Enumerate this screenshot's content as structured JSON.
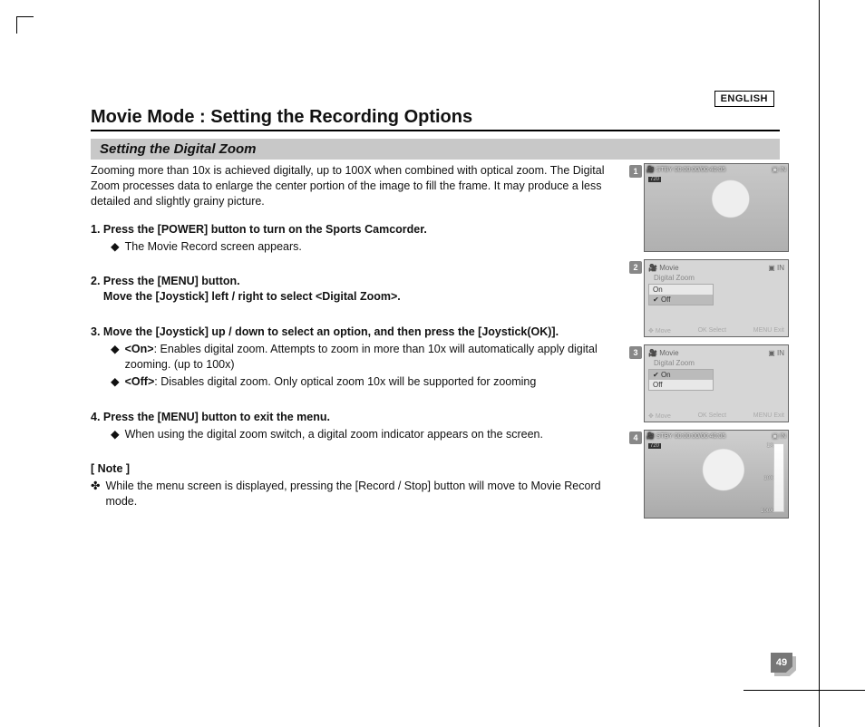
{
  "language_tag": "ENGLISH",
  "page_number": "49",
  "title": "Movie Mode : Setting the Recording Options",
  "subtitle": "Setting the Digital Zoom",
  "intro": "Zooming more than 10x is achieved digitally, up to 100X when combined with optical zoom. The Digital Zoom processes data to enlarge the center portion of the image to fill the frame. It may produce a less detailed and slightly grainy picture.",
  "steps": [
    {
      "num": "1.",
      "head": "Press the [POWER] button to turn on the Sports Camcorder.",
      "subs": [
        {
          "bullet": "◆",
          "text": "The Movie Record screen appears."
        }
      ]
    },
    {
      "num": "2.",
      "head_a": "Press the [MENU] button.",
      "head_b": "Move the [Joystick] left / right to select <Digital Zoom>.",
      "subs": []
    },
    {
      "num": "3.",
      "head": "Move the [Joystick] up / down to select an option, and then press the [Joystick(OK)].",
      "subs": [
        {
          "bullet": "◆",
          "label": "<On>",
          "text": ": Enables digital zoom. Attempts to zoom in more than 10x will automatically apply digital zooming. (up to 100x)"
        },
        {
          "bullet": "◆",
          "label": "<Off>",
          "text": ": Disables digital zoom. Only optical zoom 10x will be supported for zooming"
        }
      ]
    },
    {
      "num": "4.",
      "head": "Press the [MENU] button to exit the menu.",
      "subs": [
        {
          "bullet": "◆",
          "text": "When using the digital zoom switch, a digital zoom indicator appears on the screen."
        }
      ]
    }
  ],
  "note_head": "[ Note ]",
  "note_bullet": "✤",
  "note_text": "While the menu screen is displayed, pressing the [Record / Stop] button will move to Movie Record mode.",
  "figs": {
    "f1": {
      "stby": "STBY",
      "time": "00:00:00/00:40:05",
      "mem": "IN",
      "res": "720"
    },
    "f2": {
      "mode": "Movie",
      "setting": "Digital Zoom",
      "on": "On",
      "off": "Off",
      "move": "Move",
      "select": "Select",
      "exit": "Exit",
      "ok": "OK",
      "menu": "MENU"
    },
    "f3": {
      "mode": "Movie",
      "setting": "Digital Zoom",
      "on": "On",
      "off": "Off",
      "move": "Move",
      "select": "Select",
      "exit": "Exit",
      "ok": "OK",
      "menu": "MENU"
    },
    "f4": {
      "stby": "STBY",
      "time": "00:00:00/00:40:05",
      "mem": "IN",
      "res": "720",
      "z1": "1X",
      "z2": "10X",
      "z3": "100X"
    }
  }
}
